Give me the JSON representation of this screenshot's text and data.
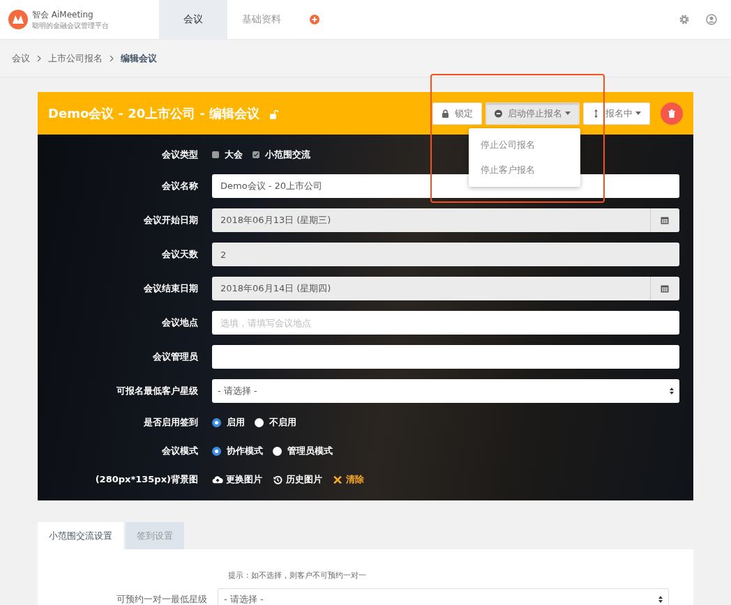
{
  "header": {
    "brand": "智会 AiMeeting",
    "tagline": "聪明的金融会议管理平台",
    "nav_tabs": [
      {
        "label": "会议",
        "selected": true
      },
      {
        "label": "基础资料",
        "selected": false
      }
    ]
  },
  "breadcrumb": [
    {
      "label": "会议",
      "current": false
    },
    {
      "label": "上市公司报名",
      "current": false
    },
    {
      "label": "编辑会议",
      "current": true
    }
  ],
  "card": {
    "title": "Demo会议 - 20上市公司 - 编辑会议",
    "buttons": [
      {
        "label": "锁定",
        "kind": "plain",
        "pressed": false
      },
      {
        "label": "启动停止报名",
        "kind": "dropdown",
        "pressed": true
      },
      {
        "label": "报名中",
        "kind": "dropdown",
        "pressed": false
      }
    ],
    "dropdown": [
      "停止公司报名",
      "停止客户报名"
    ],
    "rows": [
      {
        "label": "会议类型",
        "kind": "checkboxes",
        "options": [
          {
            "label": "大会",
            "checked": false
          },
          {
            "label": "小范围交流",
            "checked": true
          }
        ]
      },
      {
        "label": "会议名称",
        "kind": "text",
        "value": "Demo会议 - 20上市公司",
        "readonly": false
      },
      {
        "label": "会议开始日期",
        "kind": "date",
        "value": "2018年06月13日 (星期三)",
        "readonly": true
      },
      {
        "label": "会议天数",
        "kind": "text",
        "value": "2",
        "readonly": true
      },
      {
        "label": "会议结束日期",
        "kind": "date",
        "value": "2018年06月14日 (星期四)",
        "readonly": true
      },
      {
        "label": "会议地点",
        "kind": "text",
        "placeholder": "选填，请填写会议地点",
        "readonly": false
      },
      {
        "label": "会议管理员",
        "kind": "text",
        "readonly": false
      },
      {
        "label": "可报名最低客户星级",
        "kind": "select",
        "value": "- 请选择 -"
      },
      {
        "label": "是否启用签到",
        "kind": "radios",
        "options": [
          {
            "label": "启用",
            "selected": true
          },
          {
            "label": "不启用",
            "selected": false
          }
        ]
      },
      {
        "label": "会议模式",
        "kind": "radios",
        "options": [
          {
            "label": "协作模式",
            "selected": true
          },
          {
            "label": "管理员模式",
            "selected": false
          }
        ]
      },
      {
        "label": "(280px*135px)背景图",
        "kind": "image",
        "actions": [
          {
            "label": "更换图片",
            "kind": "upload"
          },
          {
            "label": "历史图片",
            "kind": "history"
          },
          {
            "label": "清除",
            "kind": "clear"
          }
        ]
      }
    ]
  },
  "settings": {
    "tabs": [
      {
        "label": "小范围交流设置",
        "selected": true
      },
      {
        "label": "签到设置",
        "selected": false
      }
    ],
    "hint": "提示：如不选择，则客户不可预约一对一",
    "row": {
      "label": "可预约一对一最低星级",
      "value": "- 请选择 -"
    }
  }
}
